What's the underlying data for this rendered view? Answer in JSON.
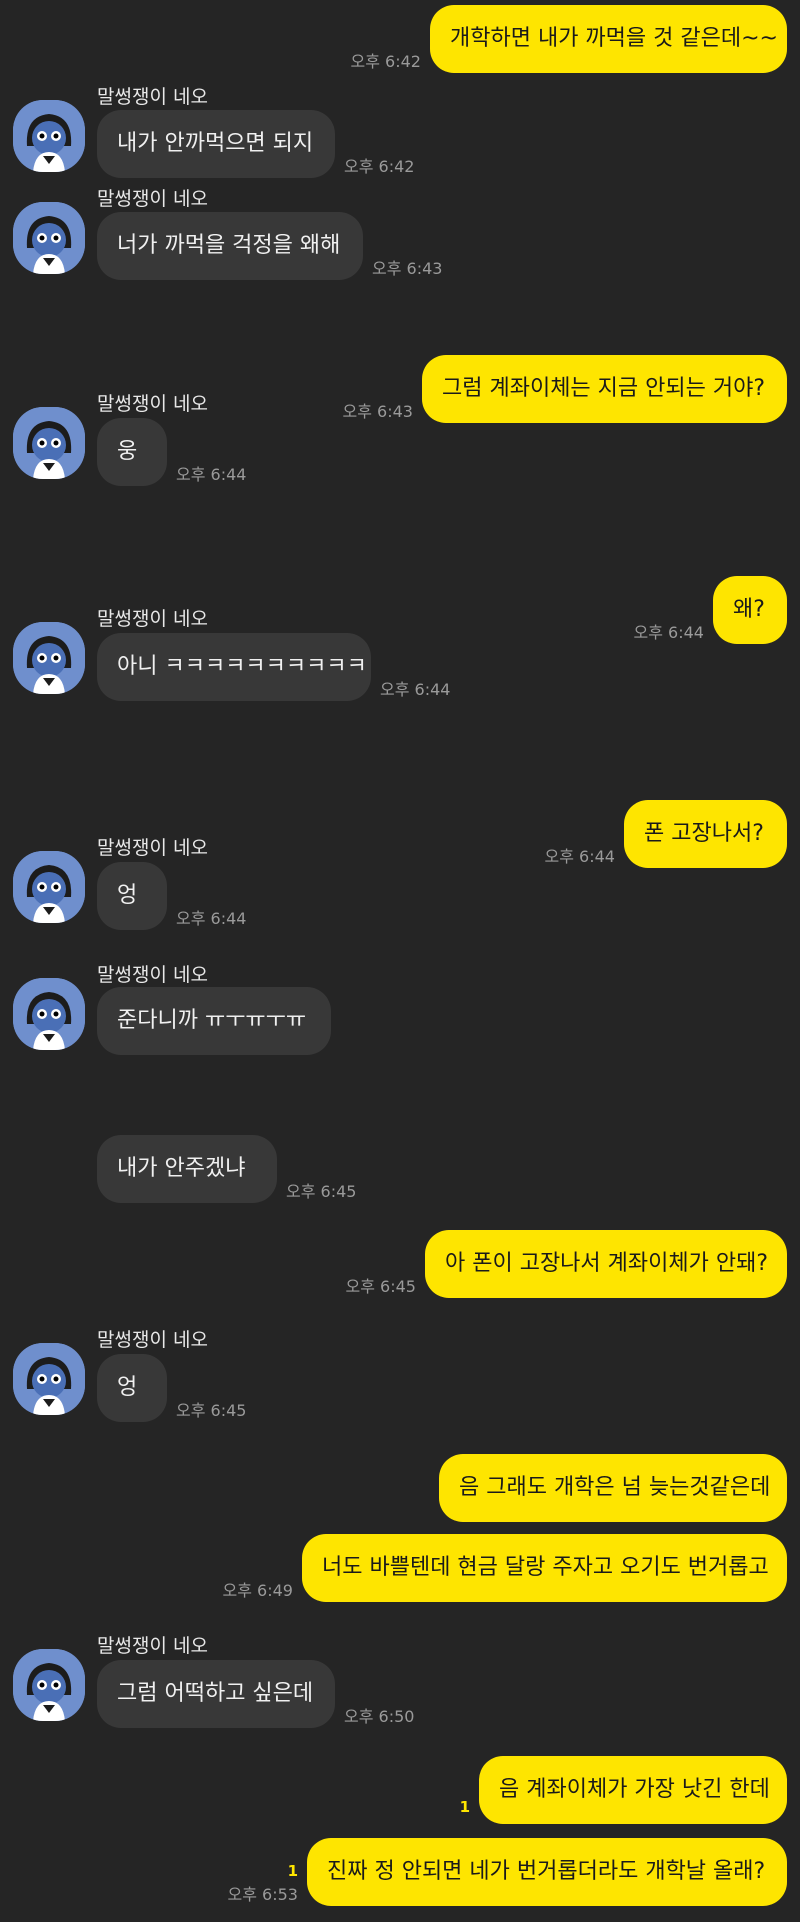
{
  "conversation": {
    "partner_name": "말썽쟁이 네오",
    "messages": [
      {
        "from": "me",
        "text": "개학하면 내가 까먹을 것 같은데~~",
        "time": "오후 6:42"
      },
      {
        "from": "them",
        "text": "내가 안까먹으면 되지",
        "time": "오후 6:42"
      },
      {
        "from": "them",
        "text": "너가 까먹을 걱정을 왜해",
        "time": "오후 6:43"
      },
      {
        "from": "me",
        "text": "그럼 계좌이체는 지금 안되는 거야?",
        "time": "오후 6:43"
      },
      {
        "from": "them",
        "text": "웅",
        "time": "오후 6:44"
      },
      {
        "from": "me",
        "text": "왜?",
        "time": "오후 6:44"
      },
      {
        "from": "them",
        "text": "아니 ㅋㅋㅋㅋㅋㅋㅋㅋㅋㅋ",
        "time": "오후 6:44"
      },
      {
        "from": "me",
        "text": "폰 고장나서?",
        "time": "오후 6:44"
      },
      {
        "from": "them",
        "text": "엉",
        "time": "오후 6:44"
      },
      {
        "from": "them",
        "text": "준다니까 ㅠㅜㅠㅜㅠ",
        "time": ""
      },
      {
        "from": "them",
        "text": "내가 안주겠냐",
        "time": "오후 6:45"
      },
      {
        "from": "me",
        "text": "아 폰이 고장나서 계좌이체가 안돼?",
        "time": "오후 6:45"
      },
      {
        "from": "them",
        "text": "엉",
        "time": "오후 6:45"
      },
      {
        "from": "me",
        "text": "음 그래도 개학은 넘 늦는것같은데",
        "time": ""
      },
      {
        "from": "me",
        "text": "너도 바쁠텐데 현금 달랑 주자고 오기도 번거롭고",
        "time": "오후 6:49"
      },
      {
        "from": "them",
        "text": "그럼 어떡하고 싶은데",
        "time": "오후 6:50"
      },
      {
        "from": "me",
        "text": "음 계좌이체가 가장 낫긴 한데",
        "time": "",
        "unread": "1"
      },
      {
        "from": "me",
        "text": "진짜 정 안되면 네가 번거롭더라도 개학날 올래?",
        "time": "오후 6:53",
        "unread": "1"
      }
    ]
  }
}
